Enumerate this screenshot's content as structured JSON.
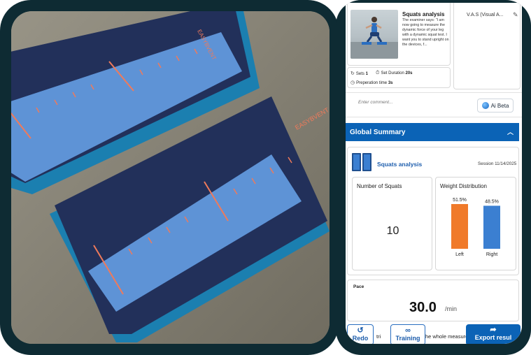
{
  "photo": {
    "device_brand": "EASYBVENT",
    "colors": {
      "device_blue": "#5e93d6",
      "device_dark": "#22305a",
      "mark_orange": "#f07a5a"
    }
  },
  "exercise": {
    "title": "Squats analysis",
    "description": "The examiner says: \"I am now going to measure the dynamic force of your leg with a dynamic squat test. I want you to stand upright on the devices, f..."
  },
  "vas": {
    "label": "V.A.S (Visual A...",
    "edit_icon": "pencil-icon"
  },
  "sets": {
    "sets_label": "Sets",
    "sets_value": "1",
    "duration_label": "Set Duration",
    "duration_value": "20s",
    "prep_label": "Preperation time",
    "prep_value": "3s"
  },
  "comment": {
    "placeholder": "Enter comment...",
    "ai_label": "Ai Beta"
  },
  "summary": {
    "header": "Global Summary",
    "title": "Squats analysis",
    "session": "Session 11/14/2025",
    "squats_label": "Number of Squats",
    "squats_value": "10",
    "weight_label": "Weight Distribution"
  },
  "chart_data": {
    "type": "bar",
    "title": "Weight Distribution",
    "categories": [
      "Left",
      "Right"
    ],
    "values": [
      51.5,
      48.5
    ],
    "data_labels": [
      "51.5%",
      "48.5%"
    ],
    "colors": [
      "#f07a2a",
      "#3b7fd1"
    ],
    "ylim": [
      0,
      60
    ]
  },
  "pace": {
    "label": "Pace",
    "value": "30.0",
    "unit": "/min"
  },
  "actions": {
    "redo": "Redo",
    "note_left": "tri",
    "training": "Training",
    "note_right": "he whole measure",
    "export": "Export resul"
  },
  "colors": {
    "primary": "#0b63b6",
    "accent_orange": "#f07a2a",
    "accent_blue": "#3b7fd1",
    "frame": "#0e2b33"
  }
}
